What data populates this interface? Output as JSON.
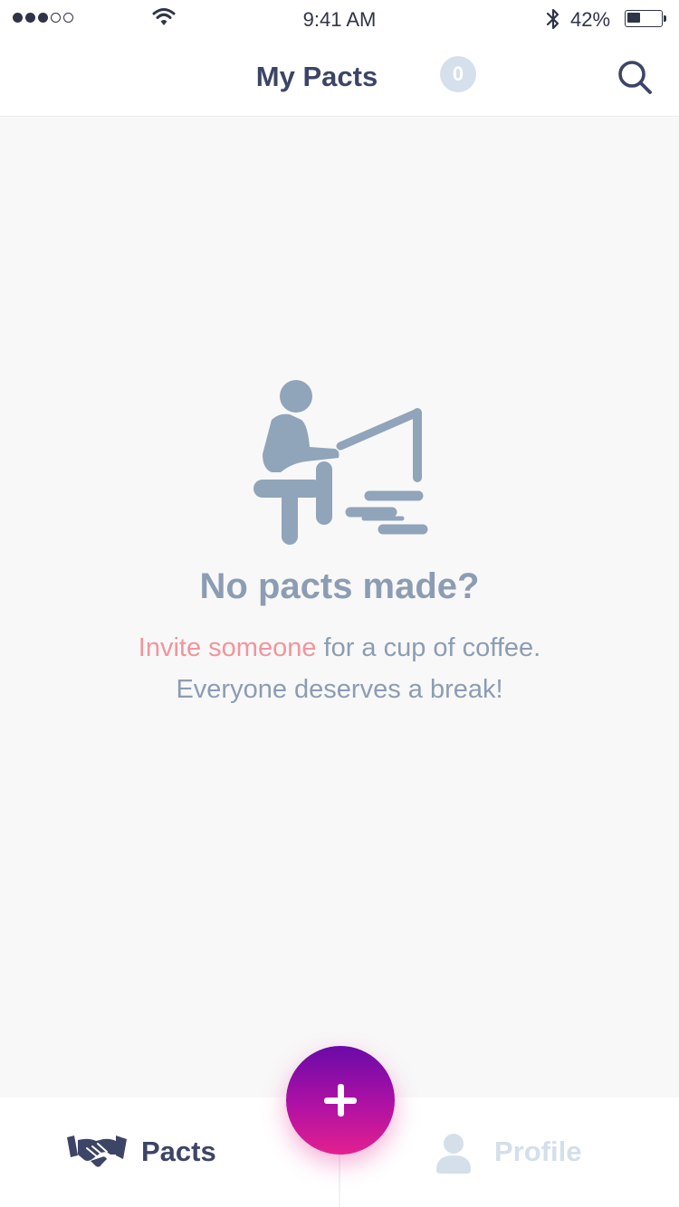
{
  "status_bar": {
    "time": "9:41 AM",
    "battery_percent_text": "42%",
    "battery_level": 0.42,
    "signal_bars_filled": 3,
    "signal_bars_total": 5
  },
  "header": {
    "title": "My Pacts",
    "count_badge": "0",
    "search_icon": "search-icon"
  },
  "empty_state": {
    "illustration_icon": "person-at-desk-icon",
    "title": "No pacts made?",
    "line1_link": "Invite someone",
    "line1_rest": " for a cup of coffee.",
    "line2": "Everyone deserves a break!"
  },
  "fab": {
    "icon": "plus-icon",
    "gradient_top": "#6a0aa8",
    "gradient_bottom": "#e3208f"
  },
  "tab_bar": {
    "tabs": [
      {
        "label": "Pacts",
        "icon": "handshake-icon",
        "active": true
      },
      {
        "label": "Profile",
        "icon": "person-icon",
        "active": false
      }
    ]
  },
  "colors": {
    "header_text": "#3d4566",
    "muted_text": "#8c9db3",
    "link_accent": "#f3949c",
    "inactive_tab": "#d4dfea",
    "badge_bg": "#d6e0ec"
  }
}
